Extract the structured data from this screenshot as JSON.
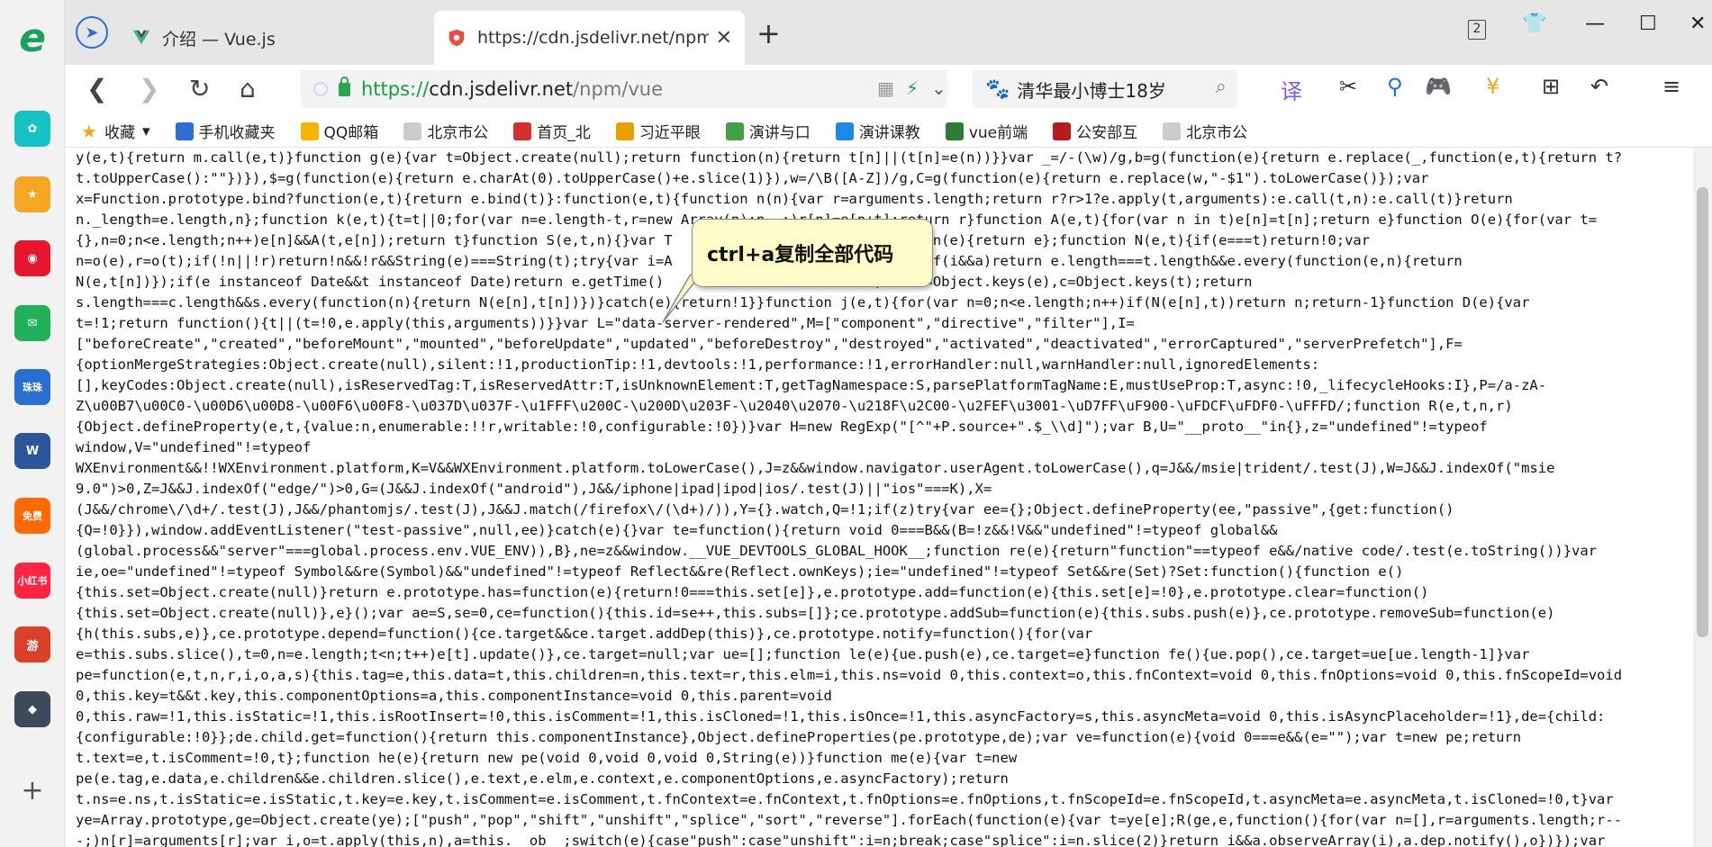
{
  "sidebar": {
    "apps": [
      {
        "name": "browser-logo",
        "color": "#1aa260",
        "glyph": "e"
      },
      {
        "name": "clover-app",
        "color": "#14c4c4",
        "glyph": "✿"
      },
      {
        "name": "favorites-star-app",
        "color": "#f5a623",
        "glyph": "★"
      },
      {
        "name": "weibo-app",
        "color": "#e6162d",
        "glyph": "◉"
      },
      {
        "name": "mail-app",
        "color": "#20b15a",
        "glyph": "✉"
      },
      {
        "name": "game-app",
        "color": "#2a6fd0",
        "glyph": "珠珠"
      },
      {
        "name": "word-app",
        "color": "#2b579a",
        "glyph": "W"
      },
      {
        "name": "novel-app",
        "color": "#ff6a00",
        "glyph": "免费"
      },
      {
        "name": "xiaohongshu-app",
        "color": "#ff2442",
        "glyph": "小红书"
      },
      {
        "name": "game2-app",
        "color": "#d9412b",
        "glyph": "游"
      },
      {
        "name": "game3-app",
        "color": "#3d4a5c",
        "glyph": "◆"
      }
    ],
    "add_label": "+"
  },
  "tabs": [
    {
      "title": "介绍 — Vue.js",
      "favicon_color": "#41b883"
    },
    {
      "title": "https://cdn.jsdelivr.net/npm/vue",
      "favicon_color": "#e84d3d"
    }
  ],
  "tab_count_badge": "2",
  "address": {
    "scheme": "https://",
    "host": "cdn.jsdelivr.net",
    "path": "/npm/vue"
  },
  "search_box": {
    "text": "清华最小博士18岁"
  },
  "bookmarks": [
    {
      "label": "收藏",
      "color": "#f5a623"
    },
    {
      "label": "手机收藏夹",
      "color": "#2b6fd6"
    },
    {
      "label": "QQ邮箱",
      "color": "#f5b400"
    },
    {
      "label": "北京市公",
      "color": "#cccccc"
    },
    {
      "label": "首页_北",
      "color": "#d32f2f"
    },
    {
      "label": "习近平眼",
      "color": "#e5a100"
    },
    {
      "label": "演讲与口",
      "color": "#43a047"
    },
    {
      "label": "演讲课教",
      "color": "#1e88e5"
    },
    {
      "label": "vue前端",
      "color": "#2e7d32"
    },
    {
      "label": "公安部互",
      "color": "#b71c1c"
    },
    {
      "label": "北京市公",
      "color": "#cccccc"
    }
  ],
  "tooltip": {
    "text": "ctrl+a复制全部代码"
  },
  "code_lines": [
    "y(e,t){return m.call(e,t)}function g(e){var t=Object.create(null);return function(n){return t[n]||(t[n]=e(n))}}var _=/-(\\w)/g,b=g(function(e){return e.replace(_,function(e,t){return t?",
    "t.toUpperCase():\"\"})}),$=g(function(e){return e.charAt(0).toUpperCase()+e.slice(1)}),w=/\\B([A-Z])/g,C=g(function(e){return e.replace(w,\"-$1\").toLowerCase()});var",
    "x=Function.prototype.bind?function(e,t){return e.bind(t)}:function(e,t){function n(n){var r=arguments.length;return r?r>1?e.apply(t,arguments):e.call(t,n):e.call(t)}return",
    "n._length=e.length,n};function k(e,t){t=t||0;for(var n=e.length-t,r=new Array(n);n--;)r[n]=e[n+t];return r}function A(e,t){for(var n in t)e[n]=t[n];return e}function O(e){for(var t=",
    "{},n=0;n<e.length;n++)e[n]&&A(t,e[n]);return t}function S(e,t,n){}var T                         unction(e){return e};function N(e,t){if(e===t)return!0;var",
    "n=o(e),r=o(t);if(!n||!r)return!n&&!r&&String(e)===String(t);try{var i=A                         y(t);if(i&&a)return e.length===t.length&&e.every(function(e,n){return",
    "N(e,t[n])});if(e instanceof Date&&t instanceof Date)return e.getTime()                         ;var s=Object.keys(e),c=Object.keys(t);return",
    "s.length===c.length&&s.every(function(n){return N(e[n],t[n])})}catch(e){return!1}}function j(e,t){for(var n=0;n<e.length;n++)if(N(e[n],t))return n;return-1}function D(e){var",
    "t=!1;return function(){t||(t=!0,e.apply(this,arguments))}}var L=\"data-server-rendered\",M=[\"component\",\"directive\",\"filter\"],I=",
    "[\"beforeCreate\",\"created\",\"beforeMount\",\"mounted\",\"beforeUpdate\",\"updated\",\"beforeDestroy\",\"destroyed\",\"activated\",\"deactivated\",\"errorCaptured\",\"serverPrefetch\"],F=",
    "{optionMergeStrategies:Object.create(null),silent:!1,productionTip:!1,devtools:!1,performance:!1,errorHandler:null,warnHandler:null,ignoredElements:",
    "[],keyCodes:Object.create(null),isReservedTag:T,isReservedAttr:T,isUnknownElement:T,getTagNamespace:S,parsePlatformTagName:E,mustUseProp:T,async:!0,_lifecycleHooks:I},P=/a-zA-",
    "Z\\u00B7\\u00C0-\\u00D6\\u00D8-\\u00F6\\u00F8-\\u037D\\u037F-\\u1FFF\\u200C-\\u200D\\u203F-\\u2040\\u2070-\\u218F\\u2C00-\\u2FEF\\u3001-\\uD7FF\\uF900-\\uFDCF\\uFDF0-\\uFFFD/;function R(e,t,n,r)",
    "{Object.defineProperty(e,t,{value:n,enumerable:!!r,writable:!0,configurable:!0})}var H=new RegExp(\"[^\"+P.source+\".$_\\\\d]\");var B,U=\"__proto__\"in{},z=\"undefined\"!=typeof",
    "window,V=\"undefined\"!=typeof",
    "WXEnvironment&&!!WXEnvironment.platform,K=V&&WXEnvironment.platform.toLowerCase(),J=z&&window.navigator.userAgent.toLowerCase(),q=J&&/msie|trident/.test(J),W=J&&J.indexOf(\"msie",
    "9.0\")>0,Z=J&&J.indexOf(\"edge/\")>0,G=(J&&J.indexOf(\"android\"),J&&/iphone|ipad|ipod|ios/.test(J)||\"ios\"===K),X=",
    "(J&&/chrome\\/\\d+/.test(J),J&&/phantomjs/.test(J),J&&J.match(/firefox\\/(\\d+)/)),Y={}.watch,Q=!1;if(z)try{var ee={};Object.defineProperty(ee,\"passive\",{get:function()",
    "{Q=!0}}),window.addEventListener(\"test-passive\",null,ee)}catch(e){}var te=function(){return void 0===B&&(B=!z&&!V&&\"undefined\"!=typeof global&&",
    "(global.process&&\"server\"===global.process.env.VUE_ENV)),B},ne=z&&window.__VUE_DEVTOOLS_GLOBAL_HOOK__;function re(e){return\"function\"==typeof e&&/native code/.test(e.toString())}var",
    "ie,oe=\"undefined\"!=typeof Symbol&&re(Symbol)&&\"undefined\"!=typeof Reflect&&re(Reflect.ownKeys);ie=\"undefined\"!=typeof Set&&re(Set)?Set:function(){function e()",
    "{this.set=Object.create(null)}return e.prototype.has=function(e){return!0===this.set[e]},e.prototype.add=function(e){this.set[e]=!0},e.prototype.clear=function()",
    "{this.set=Object.create(null)},e}();var ae=S,se=0,ce=function(){this.id=se++,this.subs=[]};ce.prototype.addSub=function(e){this.subs.push(e)},ce.prototype.removeSub=function(e)",
    "{h(this.subs,e)},ce.prototype.depend=function(){ce.target&&ce.target.addDep(this)},ce.prototype.notify=function(){for(var",
    "e=this.subs.slice(),t=0,n=e.length;t<n;t++)e[t].update()},ce.target=null;var ue=[];function le(e){ue.push(e),ce.target=e}function fe(){ue.pop(),ce.target=ue[ue.length-1]}var",
    "pe=function(e,t,n,r,i,o,a,s){this.tag=e,this.data=t,this.children=n,this.text=r,this.elm=i,this.ns=void 0,this.context=o,this.fnContext=void 0,this.fnOptions=void 0,this.fnScopeId=void",
    "0,this.key=t&&t.key,this.componentOptions=a,this.componentInstance=void 0,this.parent=void",
    "0,this.raw=!1,this.isStatic=!1,this.isRootInsert=!0,this.isComment=!1,this.isCloned=!1,this.isOnce=!1,this.asyncFactory=s,this.asyncMeta=void 0,this.isAsyncPlaceholder=!1},de={child:",
    "{configurable:!0}};de.child.get=function(){return this.componentInstance},Object.defineProperties(pe.prototype,de);var ve=function(e){void 0===e&&(e=\"\");var t=new pe;return",
    "t.text=e,t.isComment=!0,t};function he(e){return new pe(void 0,void 0,void 0,String(e))}function me(e){var t=new",
    "pe(e.tag,e.data,e.children&&e.children.slice(),e.text,e.elm,e.context,e.componentOptions,e.asyncFactory);return",
    "t.ns=e.ns,t.isStatic=e.isStatic,t.key=e.key,t.isComment=e.isComment,t.fnContext=e.fnContext,t.fnOptions=e.fnOptions,t.fnScopeId=e.fnScopeId,t.asyncMeta=e.asyncMeta,t.isCloned=!0,t}var",
    "ye=Array.prototype,ge=Object.create(ye);[\"push\",\"pop\",\"shift\",\"unshift\",\"splice\",\"sort\",\"reverse\"].forEach(function(e){var t=ye[e];R(ge,e,function(){for(var n=[],r=arguments.length;r--",
    "-;)n[r]=arguments[r];var i,o=t.apply(this,n),a=this.__ob__;switch(e){case\"push\":case\"unshift\":i=n;break;case\"splice\":i=n.slice(2)}return i&&a.observeArray(i),a.dep.notify(),o})});var"
  ]
}
